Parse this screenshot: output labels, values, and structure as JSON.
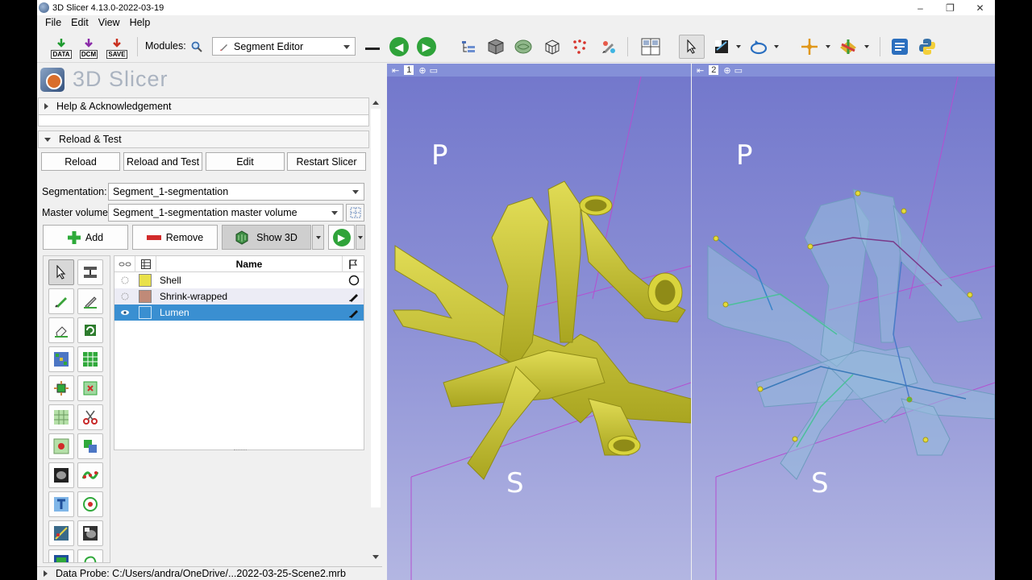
{
  "window": {
    "title": "3D Slicer 4.13.0-2022-03-19",
    "minimize": "–",
    "maximize": "❐",
    "close": "✕"
  },
  "menu": [
    "File",
    "Edit",
    "View",
    "Help"
  ],
  "toolbar": {
    "data_label": "DATA",
    "dcm_label": "DCM",
    "save_label": "SAVE",
    "modules_label": "Modules:",
    "module_selected": "Segment Editor"
  },
  "app_logo_text": "3D Slicer",
  "sections": {
    "help": "Help & Acknowledgement",
    "reload": "Reload & Test"
  },
  "reload_buttons": [
    "Reload",
    "Reload and Test",
    "Edit",
    "Restart Slicer"
  ],
  "segmentation": {
    "label": "Segmentation:",
    "value": "Segment_1-segmentation"
  },
  "master_volume": {
    "label": "Master volume:",
    "value": "Segment_1-segmentation master volume"
  },
  "actions": {
    "add": "Add",
    "remove": "Remove",
    "show3d": "Show 3D"
  },
  "segments_table": {
    "header_name": "Name",
    "rows": [
      {
        "name": "Shell",
        "color": "#e9e14a",
        "selected": false
      },
      {
        "name": "Shrink-wrapped",
        "color": "#c08a78",
        "selected": false
      },
      {
        "name": "Lumen",
        "color": "#3a8fd1",
        "selected": true
      }
    ]
  },
  "data_probe": "Data Probe: C:/Users/andra/OneDrive/...2022-03-25-Scene2.mrb",
  "views": [
    {
      "number": "1",
      "top_label": "P",
      "bottom_label": "S"
    },
    {
      "number": "2",
      "top_label": "P",
      "bottom_label": "S"
    }
  ],
  "colors": {
    "view_bg_top": "#7378cc",
    "view_bg_bottom": "#b3b6e2",
    "vessel": "#c9c531",
    "selection": "#3a8fd1"
  }
}
